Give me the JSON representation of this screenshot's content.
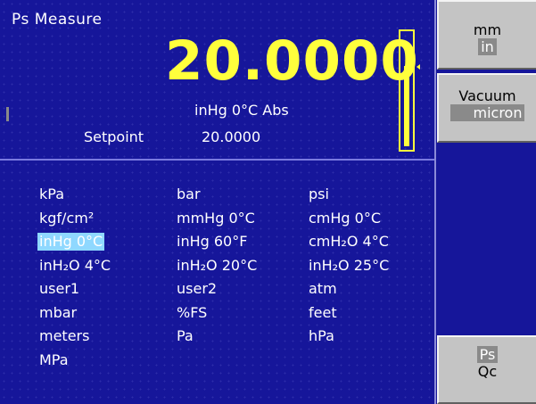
{
  "main": {
    "title": "Ps Measure",
    "reading": "20.0000",
    "reading_unit": "inHg 0°C Abs",
    "setpoint_label": "Setpoint",
    "setpoint_value": "20.0000",
    "gauge_level_percent": 72
  },
  "units": [
    [
      "kPa",
      "bar",
      "psi"
    ],
    [
      "kgf/cm²",
      "mmHg 0°C",
      "cmHg 0°C"
    ],
    [
      "inHg 0°C",
      "inHg 60°F",
      "cmH₂O 4°C"
    ],
    [
      "inH₂O 4°C",
      "inH₂O 20°C",
      "inH₂O 25°C"
    ],
    [
      "user1",
      "user2",
      "atm"
    ],
    [
      "mbar",
      "%FS",
      "feet"
    ],
    [
      "meters",
      "Pa",
      "hPa"
    ],
    [
      "MPa"
    ]
  ],
  "selected_unit": "inHg 0°C",
  "softkeys": {
    "key1": {
      "line1": "mm",
      "line2": "in"
    },
    "key2": {
      "line1": "Vacuum",
      "line2": "micron"
    },
    "key3": {
      "line1": "Ps",
      "line2": "Qc"
    }
  },
  "colors": {
    "background": "#16169a",
    "reading": "#ffff3c",
    "selection": "#8fd8ff",
    "softkey": "#c4c4c4"
  }
}
